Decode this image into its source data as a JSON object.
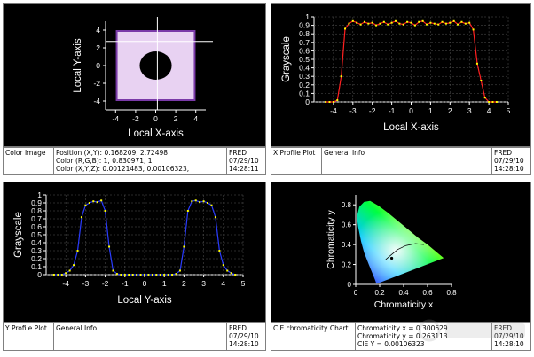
{
  "panels": {
    "color_image": {
      "title": "Color Image",
      "info": [
        "Position (X,Y): 0.168209, 2.72498",
        "Color (R,G,B): 1, 0.830971, 1",
        "Color (X,Y,Z): 0.00121483, 0.00106323,"
      ],
      "program": "FRED",
      "date": "07/29/10",
      "time": "14:28:11"
    },
    "x_profile": {
      "title": "X Profile Plot",
      "info": [
        "General Info"
      ],
      "program": "FRED",
      "date": "07/29/10",
      "time": "14:28:10"
    },
    "y_profile": {
      "title": "Y Profile Plot",
      "info": [
        "General Info"
      ],
      "program": "FRED",
      "date": "07/29/10",
      "time": "14:28:10"
    },
    "cie": {
      "title": "CIE chromaticity Chart",
      "info": [
        "Chromaticity x = 0.300629",
        "Chromaticity y = 0.263113",
        "CIE Y = 0.00106323"
      ],
      "program": "FRED",
      "date": "07/29/10",
      "time": "14:28:10"
    }
  },
  "chart_data": [
    {
      "type": "heatmap",
      "xlabel": "Local X-axis",
      "ylabel": "Local Y-axis",
      "xlim": [
        -5,
        5
      ],
      "ylim": [
        -5,
        5
      ],
      "xticks": [
        -4,
        -2,
        0,
        2,
        4
      ],
      "yticks": [
        -4,
        -2,
        0,
        2,
        4
      ],
      "square_half_width": 3.8,
      "hole_radius": 1.6,
      "colors": {
        "field": "#e8d2f2",
        "hole": "#000000"
      },
      "cursor": [
        0.168209,
        2.72498
      ]
    },
    {
      "type": "line",
      "xlabel": "Local X-axis",
      "ylabel": "Grayscale",
      "xlim": [
        -5,
        5
      ],
      "ylim": [
        0,
        1
      ],
      "xticks": [
        -4,
        -3,
        -2,
        -1,
        0,
        1,
        2,
        3,
        4,
        5
      ],
      "yticks": [
        0,
        0.1,
        0.2,
        0.3,
        0.4,
        0.5,
        0.6,
        0.7,
        0.8,
        0.9,
        1
      ],
      "colors": {
        "line": "#ff2020",
        "markers": "#ffff00"
      },
      "x": [
        -4.4,
        -4.2,
        -4.0,
        -3.8,
        -3.6,
        -3.4,
        -3.2,
        -3.0,
        -2.8,
        -2.6,
        -2.4,
        -2.2,
        -2.0,
        -1.8,
        -1.6,
        -1.4,
        -1.2,
        -1.0,
        -0.8,
        -0.6,
        -0.4,
        -0.2,
        0.0,
        0.2,
        0.4,
        0.6,
        0.8,
        1.0,
        1.2,
        1.4,
        1.6,
        1.8,
        2.0,
        2.2,
        2.4,
        2.6,
        2.8,
        3.0,
        3.2,
        3.4,
        3.6,
        3.8,
        4.0,
        4.2,
        4.4
      ],
      "y": [
        0.0,
        0.0,
        0.0,
        0.02,
        0.3,
        0.86,
        0.92,
        0.95,
        0.93,
        0.91,
        0.94,
        0.92,
        0.93,
        0.9,
        0.92,
        0.94,
        0.91,
        0.93,
        0.95,
        0.92,
        0.91,
        0.94,
        0.93,
        0.9,
        0.94,
        0.95,
        0.91,
        0.93,
        0.92,
        0.91,
        0.94,
        0.92,
        0.93,
        0.95,
        0.91,
        0.94,
        0.92,
        0.93,
        0.85,
        0.45,
        0.25,
        0.05,
        0.0,
        0.0,
        0.0
      ]
    },
    {
      "type": "line",
      "xlabel": "Local Y-axis",
      "ylabel": "Grayscale",
      "xlim": [
        -5,
        5
      ],
      "ylim": [
        0,
        1
      ],
      "xticks": [
        -4,
        -3,
        -2,
        -1,
        0,
        1,
        2,
        3,
        4,
        5
      ],
      "yticks": [
        0,
        0.1,
        0.2,
        0.3,
        0.4,
        0.5,
        0.6,
        0.7,
        0.8,
        0.9,
        1
      ],
      "colors": {
        "line": "#2a3cff",
        "markers": "#ffff00"
      },
      "x": [
        -4.6,
        -4.4,
        -4.2,
        -4.0,
        -3.8,
        -3.6,
        -3.4,
        -3.2,
        -3.0,
        -2.8,
        -2.6,
        -2.4,
        -2.2,
        -2.0,
        -1.8,
        -1.6,
        -1.4,
        -1.2,
        -1.0,
        -0.8,
        -0.6,
        -0.4,
        -0.2,
        0.0,
        0.2,
        0.4,
        0.6,
        0.8,
        1.0,
        1.2,
        1.4,
        1.6,
        1.8,
        2.0,
        2.2,
        2.4,
        2.6,
        2.8,
        3.0,
        3.2,
        3.4,
        3.6,
        3.8,
        4.0,
        4.2,
        4.4,
        4.6
      ],
      "y": [
        0.0,
        0.0,
        0.0,
        0.02,
        0.05,
        0.12,
        0.3,
        0.72,
        0.87,
        0.9,
        0.92,
        0.91,
        0.93,
        0.8,
        0.35,
        0.05,
        0.01,
        0.0,
        0.0,
        0.0,
        0.0,
        0.0,
        0.0,
        0.0,
        0.0,
        0.0,
        0.0,
        0.0,
        0.0,
        0.0,
        0.0,
        0.01,
        0.05,
        0.35,
        0.8,
        0.92,
        0.93,
        0.91,
        0.92,
        0.9,
        0.87,
        0.72,
        0.3,
        0.12,
        0.05,
        0.02,
        0.0
      ]
    },
    {
      "type": "scatter",
      "xlabel": "Chromaticity x",
      "ylabel": "Chromaticity y",
      "xlim": [
        0,
        0.8
      ],
      "ylim": [
        0,
        0.9
      ],
      "xticks": [
        0,
        0.2,
        0.4,
        0.6,
        0.8
      ],
      "yticks": [
        0,
        0.2,
        0.4,
        0.6,
        0.8
      ],
      "point": [
        0.300629,
        0.263113
      ]
    }
  ]
}
